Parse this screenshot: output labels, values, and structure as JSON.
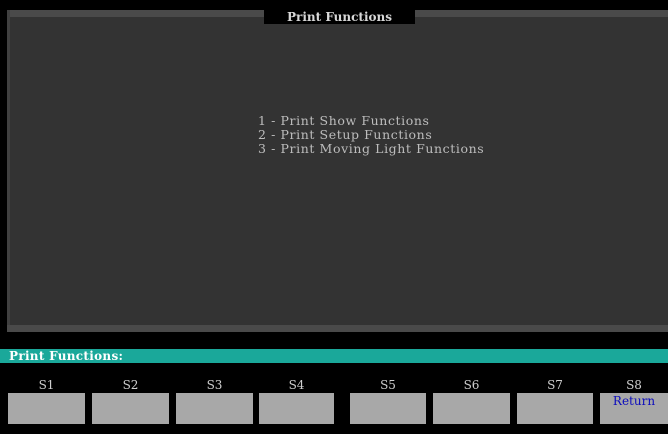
{
  "window": {
    "title": "Print Functions"
  },
  "menu": {
    "items": [
      {
        "label": "1 - Print Show Functions"
      },
      {
        "label": "2 - Print Setup Functions"
      },
      {
        "label": "3 - Print Moving Light Functions"
      }
    ]
  },
  "status_bar": {
    "text": "Print Functions:",
    "color": "#1aa89a"
  },
  "softkeys": [
    {
      "label": "S1",
      "text": ""
    },
    {
      "label": "S2",
      "text": ""
    },
    {
      "label": "S3",
      "text": ""
    },
    {
      "label": "S4",
      "text": ""
    },
    {
      "label": "S5",
      "text": ""
    },
    {
      "label": "S6",
      "text": ""
    },
    {
      "label": "S7",
      "text": ""
    },
    {
      "label": "S8",
      "text": "Return"
    }
  ],
  "colors": {
    "background": "#000000",
    "panel": "#333333",
    "softkey_button": "#a8a8a8",
    "softkey_text": "#0b0bbd"
  }
}
